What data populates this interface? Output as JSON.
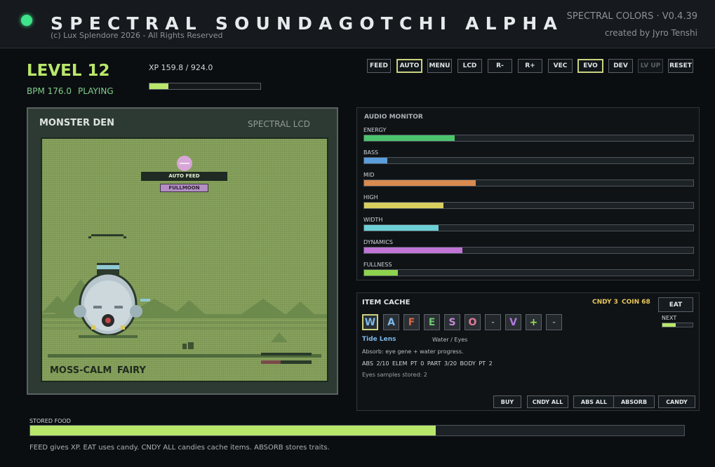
{
  "header": {
    "title": "SPECTRAL SOUNDAGOTCHI ALPHA",
    "copyright": "(c) Lux Splendore 2026 - All Rights Reserved",
    "brand": "SPECTRAL COLORS · V0.4.39",
    "author": "created by Jyro Tenshi"
  },
  "status": {
    "level": "LEVEL 12",
    "bpm": "BPM 176.0",
    "state": "PLAYING",
    "xp_text": "XP 159.8 / 924.0",
    "xp_fraction": 0.173
  },
  "toolbar": [
    {
      "label": "FEED",
      "active": false,
      "disabled": false
    },
    {
      "label": "AUTO",
      "active": true,
      "disabled": false
    },
    {
      "label": "MENU",
      "active": false,
      "disabled": false
    },
    {
      "label": "LCD",
      "active": false,
      "disabled": false
    },
    {
      "label": "R-",
      "active": false,
      "disabled": false
    },
    {
      "label": "R+",
      "active": false,
      "disabled": false
    },
    {
      "label": "VEC",
      "active": false,
      "disabled": false
    },
    {
      "label": "EVO",
      "active": true,
      "disabled": false
    },
    {
      "label": "DEV",
      "active": false,
      "disabled": false
    },
    {
      "label": "LV UP",
      "active": false,
      "disabled": true
    },
    {
      "label": "RESET",
      "active": false,
      "disabled": false
    }
  ],
  "den": {
    "title": "MONSTER DEN",
    "subtitle": "SPECTRAL LCD",
    "auto_feed": "AUTO FEED",
    "moon": "FULLMOON",
    "pet_name": "MOSS-CALM FAIRY"
  },
  "audio": {
    "title": "AUDIO MONITOR",
    "meters": [
      {
        "label": "ENERGY",
        "value": 0.275,
        "color": "#4cc46e"
      },
      {
        "label": "BASS",
        "value": 0.07,
        "color": "#5b9ddb"
      },
      {
        "label": "MID",
        "value": 0.34,
        "color": "#d98a4f"
      },
      {
        "label": "HIGH",
        "value": 0.24,
        "color": "#d8cf5e"
      },
      {
        "label": "WIDTH",
        "value": 0.227,
        "color": "#6ccfd6"
      },
      {
        "label": "DYNAMICS",
        "value": 0.298,
        "color": "#c075d6"
      },
      {
        "label": "FULLNESS",
        "value": 0.103,
        "color": "#8ed34d"
      }
    ]
  },
  "cache": {
    "title": "ITEM CACHE",
    "candy": "CNDY 3",
    "coin": "COIN 68",
    "eat": "EAT",
    "next": "NEXT",
    "next_fraction": 0.45,
    "slots": [
      {
        "glyph": "W",
        "color": "#7bb8e8",
        "selected": true
      },
      {
        "glyph": "A",
        "color": "#7bb8e8",
        "selected": false
      },
      {
        "glyph": "F",
        "color": "#d9663f",
        "selected": false
      },
      {
        "glyph": "E",
        "color": "#6cc46e",
        "selected": false
      },
      {
        "glyph": "S",
        "color": "#c58bd9",
        "selected": false
      },
      {
        "glyph": "O",
        "color": "#e07a9a",
        "selected": false
      },
      {
        "glyph": "-",
        "color": "#8b9296",
        "selected": false
      },
      {
        "glyph": "V",
        "color": "#b07be0",
        "selected": false
      },
      {
        "glyph": "+",
        "color": "#9adf5c",
        "selected": false
      },
      {
        "glyph": "-",
        "color": "#8b9296",
        "selected": false
      }
    ],
    "item_name": "Tide Lens",
    "item_type": "Water / Eyes",
    "item_desc": "Absorb: eye gene + water progress.",
    "item_stats": "ABS 2/10 ELEM PT 0 PART 3/20 BODY PT 2",
    "item_samples": "Eyes samples stored: 2",
    "buttons": [
      "BUY",
      "CNDY ALL",
      "ABS ALL",
      "ABSORB",
      "CANDY"
    ]
  },
  "food": {
    "label": "STORED FOOD",
    "fraction": 0.62
  },
  "help": "FEED gives XP. EAT uses candy. CNDY ALL candies cache items. ABSORB stores traits."
}
